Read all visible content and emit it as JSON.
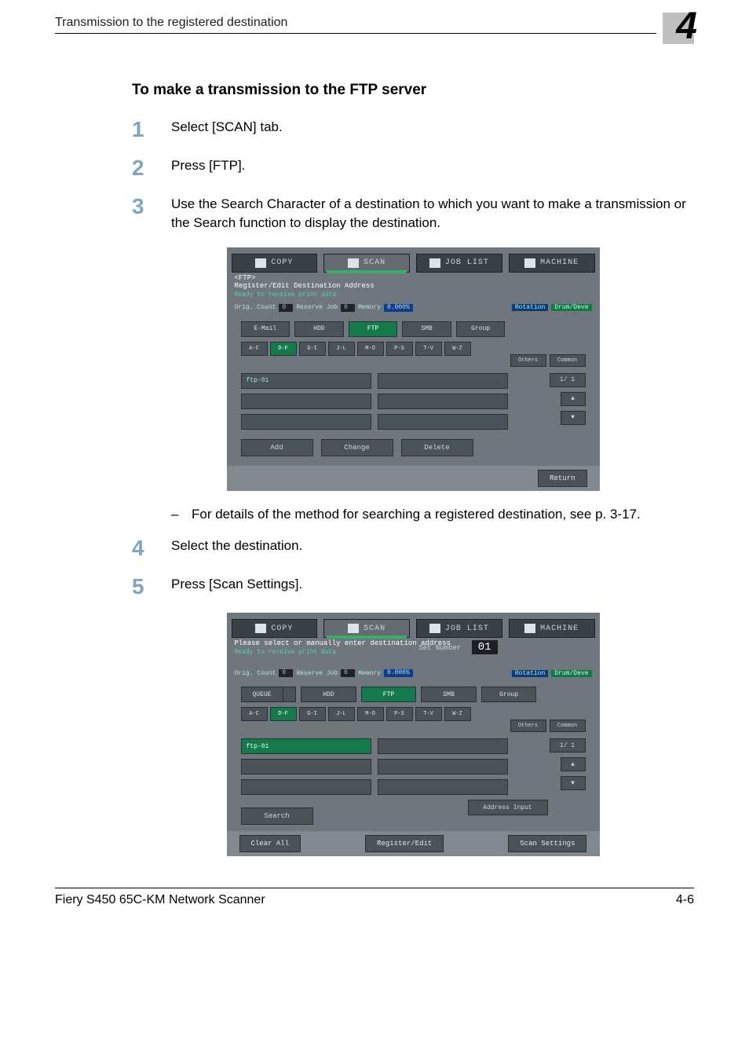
{
  "header": {
    "running_title": "Transmission to the registered destination",
    "chapter_number": "4"
  },
  "section_title": "To make a transmission to the FTP server",
  "steps": {
    "s1": {
      "num": "1",
      "text": "Select [SCAN] tab."
    },
    "s2": {
      "num": "2",
      "text": "Press [FTP]."
    },
    "s3": {
      "num": "3",
      "text": "Use the Search Character of a destination to which you want to make a transmission or the Search function to display the destination."
    },
    "s3_sub": {
      "text": "For details of the method for searching a registered destination, see p. 3-17."
    },
    "s4": {
      "num": "4",
      "text": "Select the destination."
    },
    "s5": {
      "num": "5",
      "text": "Press [Scan Settings]."
    }
  },
  "tabs": {
    "copy": "COPY",
    "scan": "SCAN",
    "joblist": "JOB LIST",
    "machine": "MACHINE"
  },
  "shot_common": {
    "ready": "Ready to receive print data",
    "orig_count_label": "Orig. Count",
    "orig_count_value": "0",
    "reserve_label": "Reserve Job",
    "reserve_value": "0",
    "memory_label": "Memory",
    "memory_value": "0.000%",
    "rotation": "Rotation",
    "drum": "Drum/Deve",
    "cats": {
      "email": "E-Mail",
      "hdd": "HDD",
      "ftp": "FTP",
      "smb": "SMB",
      "group": "Group",
      "queue": "QUEUE"
    },
    "alpha": {
      "ac": "A-C",
      "df": "D-F",
      "gi": "G-I",
      "jl": "J-L",
      "mo": "M-O",
      "ps": "P-S",
      "tv": "T-V",
      "wz": "W-Z"
    },
    "others": "Others",
    "common": "Common",
    "entry": "ftp-01",
    "page_ind": "1/ 1",
    "up": "▲",
    "down": "▼"
  },
  "shot1": {
    "title1": "<FTP>",
    "title2": "Register/Edit Destination Address",
    "add": "Add",
    "change": "Change",
    "delete": "Delete",
    "return": "Return"
  },
  "shot2": {
    "title": "Please select or manually enter destination address",
    "setnum_label": "Set Number",
    "setnum_value": "01",
    "address_input": "Address Input",
    "search": "Search",
    "clear_all": "Clear All",
    "register_edit": "Register/Edit",
    "scan_settings": "Scan Settings"
  },
  "footer": {
    "product": "Fiery S450 65C-KM Network Scanner",
    "page": "4-6"
  }
}
